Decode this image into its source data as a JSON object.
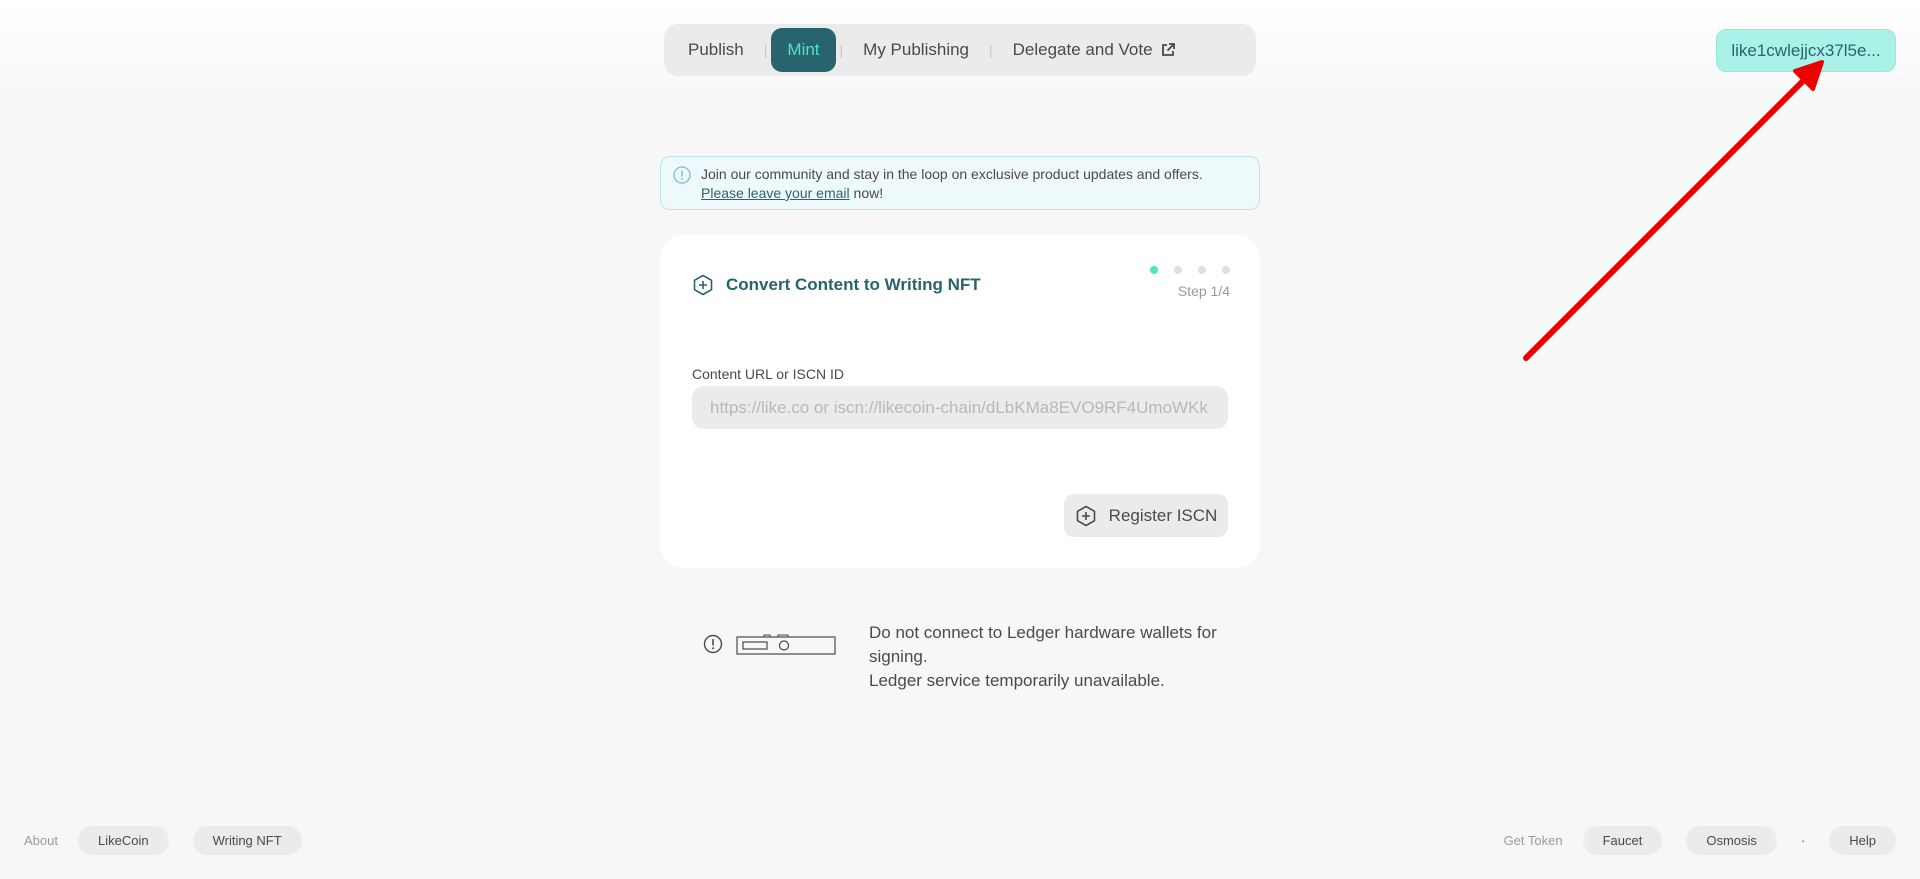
{
  "nav": {
    "items": [
      {
        "label": "Publish"
      },
      {
        "label": "Mint"
      },
      {
        "label": "My Publishing"
      },
      {
        "label": "Delegate and Vote"
      }
    ],
    "separator": "|"
  },
  "wallet": {
    "address": "like1cwlejjcx37l5e..."
  },
  "notice": {
    "text": "Join our community and stay in the loop on exclusive product updates and offers.",
    "link_text": "Please leave your email",
    "suffix": " now!"
  },
  "card": {
    "title": "Convert Content to Writing NFT",
    "step": "Step 1/4",
    "total_steps": 4,
    "current_step": 1,
    "field_label": "Content URL or ISCN ID",
    "field_placeholder": "https://like.co or iscn://likecoin-chain/dLbKMa8EVO9RF4UmoWKk",
    "field_value": "",
    "register_label": "Register ISCN"
  },
  "ledger": {
    "line1": "Do not connect to Ledger hardware wallets for signing.",
    "line2": "Ledger service temporarily unavailable."
  },
  "footer": {
    "about_label": "About",
    "left_links": [
      "LikeCoin",
      "Writing NFT"
    ],
    "get_token_label": "Get Token",
    "right_links": [
      "Faucet",
      "Osmosis"
    ],
    "dot": "·",
    "help": "Help"
  },
  "colors": {
    "accent_dark": "#28646e",
    "accent_light": "#50e3c2",
    "wallet_bg": "#aaf1e7",
    "annotation_arrow": "#ee0000"
  }
}
